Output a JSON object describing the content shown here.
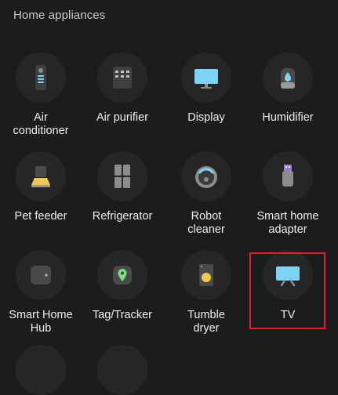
{
  "section": {
    "title": "Home appliances"
  },
  "tiles": [
    {
      "label": "Air\nconditioner",
      "icon": "remote-icon"
    },
    {
      "label": "Air purifier",
      "icon": "air-purifier-icon"
    },
    {
      "label": "Display",
      "icon": "display-icon"
    },
    {
      "label": "Humidifier",
      "icon": "humidifier-icon"
    },
    {
      "label": "Pet feeder",
      "icon": "pet-feeder-icon"
    },
    {
      "label": "Refrigerator",
      "icon": "refrigerator-icon"
    },
    {
      "label": "Robot\ncleaner",
      "icon": "robot-cleaner-icon"
    },
    {
      "label": "Smart home\nadapter",
      "icon": "usb-adapter-icon"
    },
    {
      "label": "Smart Home\nHub",
      "icon": "hub-icon"
    },
    {
      "label": "Tag/Tracker",
      "icon": "tag-tracker-icon"
    },
    {
      "label": "Tumble\ndryer",
      "icon": "tumble-dryer-icon"
    },
    {
      "label": "TV",
      "icon": "tv-icon"
    }
  ],
  "colors": {
    "background": "#1c1c1c",
    "circle": "#262626",
    "accent_blue": "#7fd3f5",
    "accent_yellow": "#f5c84a",
    "accent_green": "#7ee07a",
    "highlight": "#e0202a"
  }
}
